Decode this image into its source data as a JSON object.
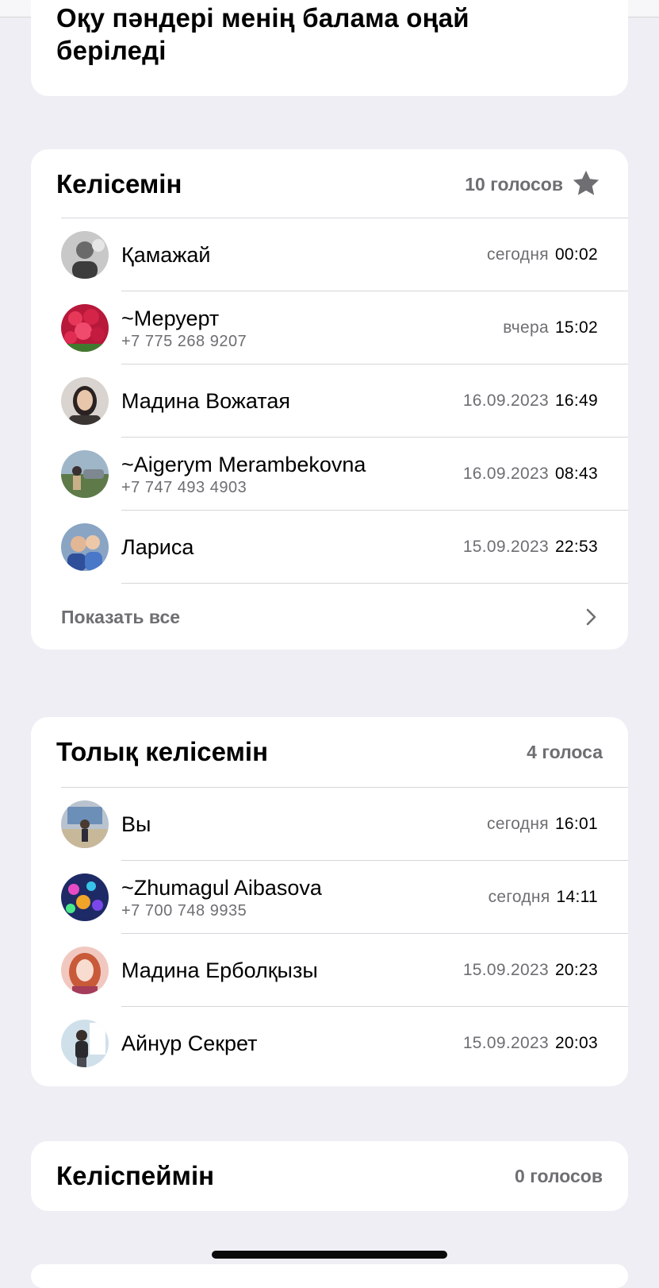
{
  "question": {
    "text": "Оқу пәндері менің балама оңай беріледі"
  },
  "options": [
    {
      "title": "Келісемін",
      "count": "10 голосов",
      "starred": true,
      "voters": [
        {
          "name": "Қамажай",
          "phone": "",
          "date": "сегодня",
          "time": "00:02"
        },
        {
          "name": "~Меруерт",
          "phone": "+7 775 268 9207",
          "date": "вчера",
          "time": "15:02"
        },
        {
          "name": "Мадина Вожатая",
          "phone": "",
          "date": "16.09.2023",
          "time": "16:49"
        },
        {
          "name": "~Aigerym Merambekovna",
          "phone": "+7 747 493 4903",
          "date": "16.09.2023",
          "time": "08:43"
        },
        {
          "name": "Лариса",
          "phone": "",
          "date": "15.09.2023",
          "time": "22:53"
        }
      ],
      "show_all": "Показать все"
    },
    {
      "title": "Толық келісемін",
      "count": "4 голоса",
      "starred": false,
      "voters": [
        {
          "name": "Вы",
          "phone": "",
          "date": "сегодня",
          "time": "16:01"
        },
        {
          "name": "~Zhumagul Aibasova",
          "phone": "+7 700 748 9935",
          "date": "сегодня",
          "time": "14:11"
        },
        {
          "name": "Мадина Ерболқызы",
          "phone": "",
          "date": "15.09.2023",
          "time": "20:23"
        },
        {
          "name": "Айнур Секрет",
          "phone": "",
          "date": "15.09.2023",
          "time": "20:03"
        }
      ]
    },
    {
      "title": "Келіспеймін",
      "count": "0 голосов",
      "starred": false,
      "voters": []
    }
  ],
  "icons": {
    "star": "star-icon",
    "chevron": "chevron-right-icon"
  },
  "colors": {
    "background": "#efeef4",
    "card": "#ffffff",
    "secondary_text": "#6e6e73",
    "divider": "#d6d6da"
  }
}
